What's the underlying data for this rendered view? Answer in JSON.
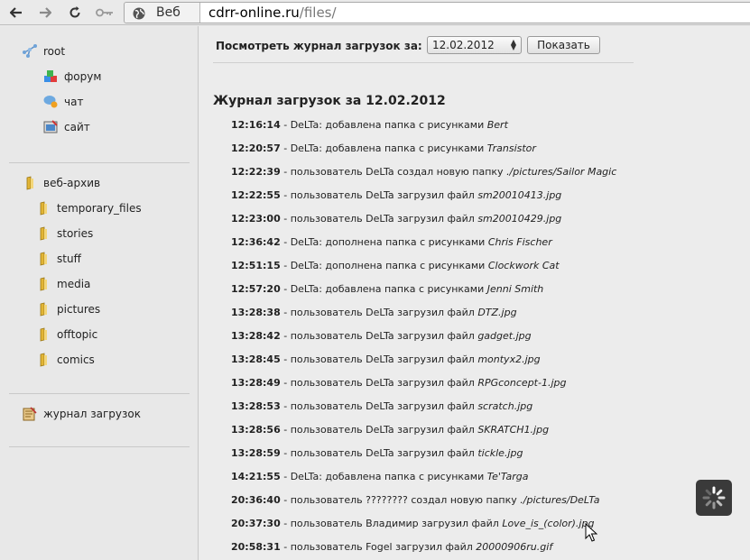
{
  "browser": {
    "site_label": "Веб",
    "url_host": "cdrr-online.ru",
    "url_path": "/files/"
  },
  "sidebar": {
    "root": {
      "label": "root"
    },
    "root_children": [
      {
        "label": "форум",
        "icon": "forum-icon"
      },
      {
        "label": "чат",
        "icon": "chat-icon"
      },
      {
        "label": "сайт",
        "icon": "site-icon"
      }
    ],
    "archive": {
      "label": "веб-архив"
    },
    "folders": [
      {
        "label": "temporary_files"
      },
      {
        "label": "stories"
      },
      {
        "label": "stuff"
      },
      {
        "label": "media"
      },
      {
        "label": "pictures"
      },
      {
        "label": "offtopic"
      },
      {
        "label": "comics"
      }
    ],
    "log_link": {
      "label": "журнал загрузок"
    }
  },
  "filter": {
    "label": "Посмотреть журнал загрузок за:",
    "date": "12.02.2012",
    "button": "Показать"
  },
  "log": {
    "title": "Журнал загрузок за 12.02.2012",
    "entries": [
      {
        "time": "12:16:14",
        "text": " - DeLTa: добавлена папка с рисунками ",
        "name": "Bert"
      },
      {
        "time": "12:20:57",
        "text": " - DeLTa: добавлена папка с рисунками ",
        "name": "Transistor"
      },
      {
        "time": "12:22:39",
        "text": " - пользователь DeLTa создал новую папку ",
        "name": "./pictures/Sailor Magic"
      },
      {
        "time": "12:22:55",
        "text": " - пользователь DeLTa загрузил файл ",
        "name": "sm20010413.jpg"
      },
      {
        "time": "12:23:00",
        "text": " - пользователь DeLTa загрузил файл ",
        "name": "sm20010429.jpg"
      },
      {
        "time": "12:36:42",
        "text": " - DeLTa: дополнена папка с рисунками ",
        "name": "Chris Fischer"
      },
      {
        "time": "12:51:15",
        "text": " - DeLTa: дополнена папка с рисунками ",
        "name": "Clockwork Cat"
      },
      {
        "time": "12:57:20",
        "text": " - DeLTa: добавлена папка с рисунками ",
        "name": "Jenni Smith"
      },
      {
        "time": "13:28:38",
        "text": " - пользователь DeLTa загрузил файл ",
        "name": "DTZ.jpg"
      },
      {
        "time": "13:28:42",
        "text": " - пользователь DeLTa загрузил файл ",
        "name": "gadget.jpg"
      },
      {
        "time": "13:28:45",
        "text": " - пользователь DeLTa загрузил файл ",
        "name": "montyx2.jpg"
      },
      {
        "time": "13:28:49",
        "text": " - пользователь DeLTa загрузил файл ",
        "name": "RPGconcept-1.jpg"
      },
      {
        "time": "13:28:53",
        "text": " - пользователь DeLTa загрузил файл ",
        "name": "scratch.jpg"
      },
      {
        "time": "13:28:56",
        "text": " - пользователь DeLTa загрузил файл ",
        "name": "SKRATCH1.jpg"
      },
      {
        "time": "13:28:59",
        "text": " - пользователь DeLTa загрузил файл ",
        "name": "tickle.jpg"
      },
      {
        "time": "14:21:55",
        "text": " - DeLTa: добавлена папка с рисунками ",
        "name": "Te'Targa"
      },
      {
        "time": "20:36:40",
        "text": " - пользователь ???????? создал новую папку ",
        "name": "./pictures/DeLTa"
      },
      {
        "time": "20:37:30",
        "text": " - пользователь Владимир загрузил файл ",
        "name": "Love_is_(color).jpg"
      },
      {
        "time": "20:58:31",
        "text": " - пользователь Fogel загрузил файл ",
        "name": "20000906ru.gif"
      }
    ]
  }
}
